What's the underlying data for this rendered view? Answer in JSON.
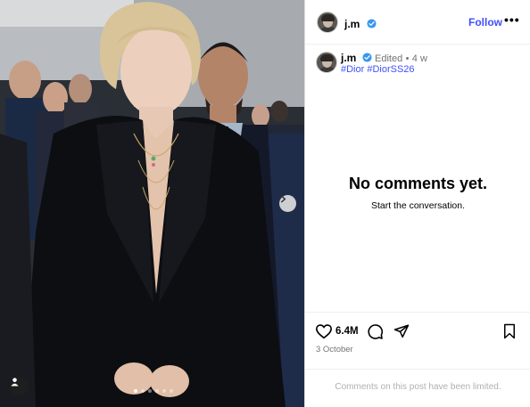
{
  "post": {
    "username": "j.m",
    "follow_label": "Follow",
    "more_label": "•••",
    "caption_username": "j.m",
    "edited_label": "Edited",
    "separator": "•",
    "age": "4 w",
    "hashtags": "#Dior #DiorSS26",
    "likes": "6.4M",
    "date": "3 October",
    "carousel": {
      "total_slides": 6,
      "active_slide": 1
    }
  },
  "comments": {
    "empty_title": "No comments yet.",
    "empty_subtitle": "Start the conversation.",
    "limited_notice": "Comments on this post have been limited."
  },
  "colors": {
    "accent": "#4150f7",
    "verified": "#3897f0",
    "muted": "#737373",
    "border": "#dbdbdb"
  },
  "icons": {
    "next": "chevron-right-icon",
    "user_tag": "person-icon",
    "like": "heart-icon",
    "comment": "speech-bubble-icon",
    "share": "paper-plane-icon",
    "save": "bookmark-icon",
    "verified": "verified-badge-icon"
  }
}
